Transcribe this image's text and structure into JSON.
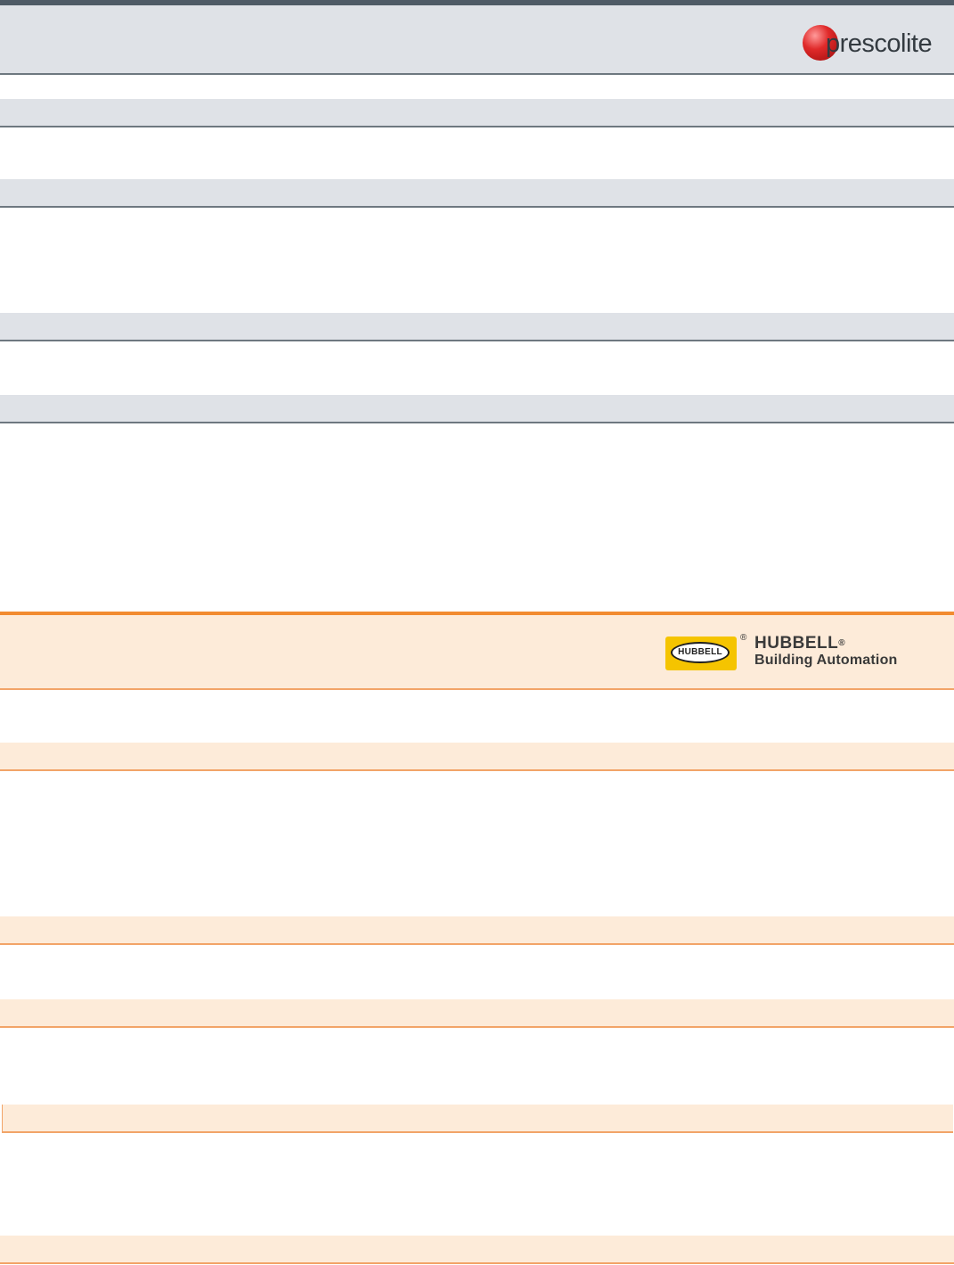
{
  "brand_primary": {
    "name": "prescolite",
    "icon": "prescolite-logo-icon",
    "colors": {
      "ball": "#e02a2a",
      "text": "#333a40",
      "band": "#dfe2e7",
      "rule": "#4f5b66"
    }
  },
  "brand_secondary": {
    "badge_text": "HUBBELL",
    "registered_mark": "®",
    "name": "HUBBELL",
    "name_mark": "®",
    "subtitle": "Building Automation",
    "icon": "hubbell-logo-icon",
    "colors": {
      "badge": "#f5c400",
      "band": "#fdebd9",
      "rule": "#f28b30"
    }
  }
}
